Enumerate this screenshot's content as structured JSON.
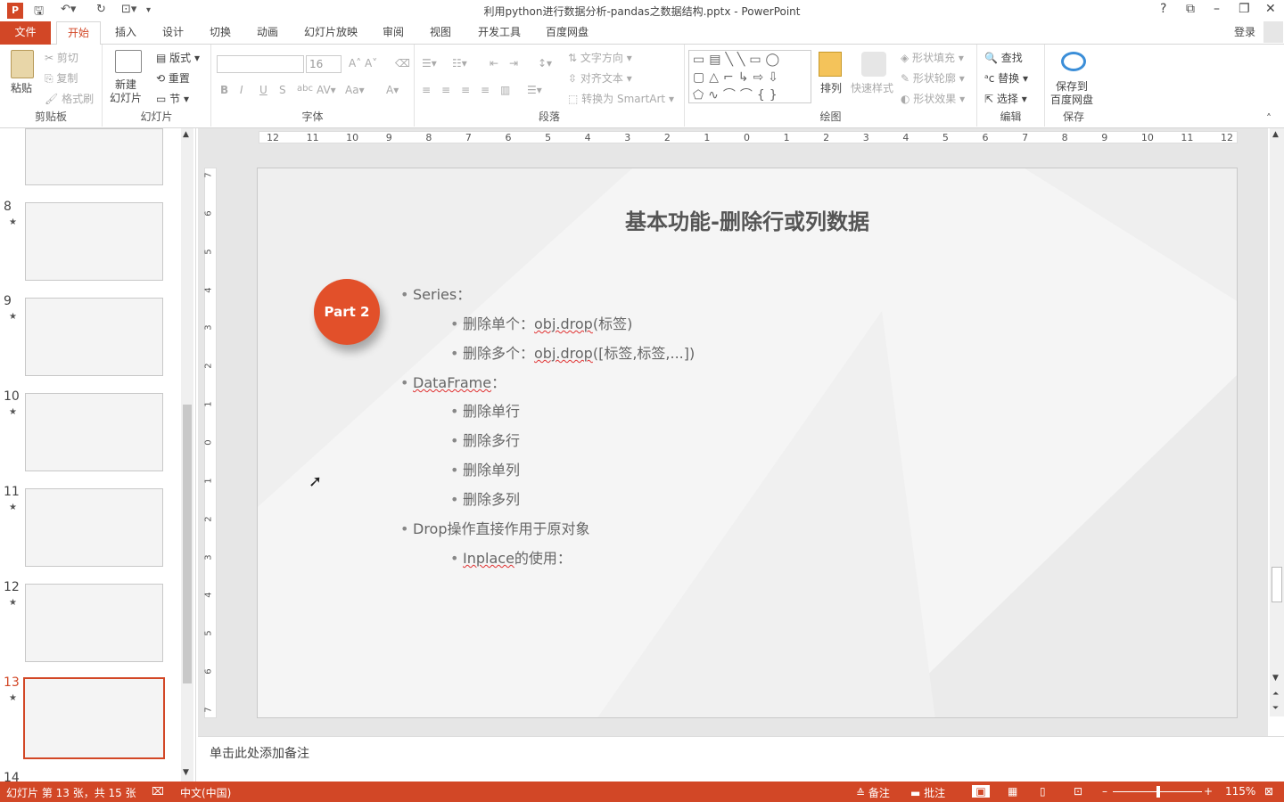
{
  "window": {
    "title": "利用python进行数据分析-pandas之数据结构.pptx - PowerPoint"
  },
  "tabs": [
    "文件",
    "开始",
    "插入",
    "设计",
    "切换",
    "动画",
    "幻灯片放映",
    "审阅",
    "视图",
    "开发工具",
    "百度网盘"
  ],
  "login": "登录",
  "ribbon": {
    "clipboard": {
      "paste": "粘贴",
      "cut": "剪切",
      "copy": "复制",
      "format_painter": "格式刷",
      "label": "剪贴板"
    },
    "slides": {
      "new_slide": "新建\n幻灯片",
      "layout": "版式",
      "reset": "重置",
      "section": "节",
      "label": "幻灯片"
    },
    "font": {
      "name": "",
      "size": "16",
      "label": "字体"
    },
    "paragraph": {
      "text_direction": "文字方向",
      "align_text": "对齐文本",
      "smartart": "转换为 SmartArt",
      "label": "段落"
    },
    "drawing": {
      "arrange": "排列",
      "quick_styles": "快速样式",
      "shape_fill": "形状填充",
      "shape_outline": "形状轮廓",
      "shape_effects": "形状效果",
      "label": "绘图"
    },
    "editing": {
      "find": "查找",
      "replace": "替换",
      "select": "选择",
      "label": "编辑"
    },
    "save": {
      "save_to": "保存到\n百度网盘",
      "label": "保存"
    }
  },
  "thumbnails": [
    {
      "num": "8"
    },
    {
      "num": "9"
    },
    {
      "num": "10"
    },
    {
      "num": "11"
    },
    {
      "num": "12"
    },
    {
      "num": "13"
    },
    {
      "num": "14"
    }
  ],
  "ruler": {
    "h_ticks": [
      "12",
      "11",
      "10",
      "9",
      "8",
      "7",
      "6",
      "5",
      "4",
      "3",
      "2",
      "1",
      "0",
      "1",
      "2",
      "3",
      "4",
      "5",
      "6",
      "7",
      "8",
      "9",
      "10",
      "11",
      "12"
    ],
    "v_ticks": [
      "7",
      "6",
      "5",
      "4",
      "3",
      "2",
      "1",
      "0",
      "1",
      "2",
      "3",
      "4",
      "5",
      "6",
      "7"
    ]
  },
  "slide": {
    "title": "基本功能-删除行或列数据",
    "badge": "Part 2",
    "bullets": [
      {
        "level": 1,
        "text": "Series："
      },
      {
        "level": 2,
        "prefix": "删除单个：",
        "code": "obj.drop",
        "suffix": "(标签)"
      },
      {
        "level": 2,
        "prefix": "删除多个：",
        "code": "obj.drop",
        "suffix": "([标签,标签,...])"
      },
      {
        "level": 1,
        "code": "DataFrame",
        "suffix": "："
      },
      {
        "level": 2,
        "text": "删除单行"
      },
      {
        "level": 2,
        "text": "删除多行"
      },
      {
        "level": 2,
        "text": "删除单列"
      },
      {
        "level": 2,
        "text": "删除多列"
      },
      {
        "level": 1,
        "text": "Drop操作直接作用于原对象"
      },
      {
        "level": 2,
        "code": "Inplace",
        "suffix": "的使用："
      }
    ]
  },
  "notes": {
    "placeholder": "单击此处添加备注"
  },
  "status": {
    "slide_info": "幻灯片 第 13 张，共 15 张",
    "language": "中文(中国)",
    "notes_btn": "备注",
    "comments_btn": "批注",
    "zoom": "115%"
  },
  "colors": {
    "accent": "#d24726",
    "badge": "#e2502a"
  }
}
